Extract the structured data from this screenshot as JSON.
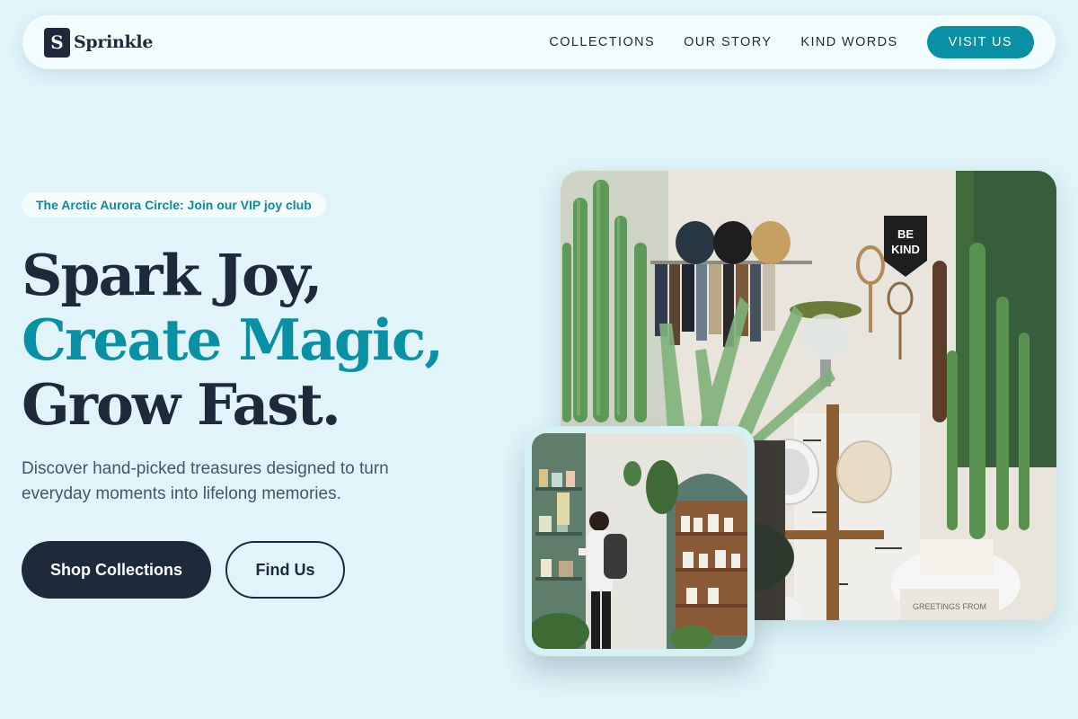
{
  "brand": {
    "logo_letter": "S",
    "name": "Sprinkle"
  },
  "nav": {
    "links": [
      "COLLECTIONS",
      "OUR STORY",
      "KIND WORDS"
    ],
    "cta": "VISIT US"
  },
  "hero": {
    "badge": "The Arctic Aurora Circle: Join our VIP joy club",
    "headline": [
      "Spark Joy,",
      "Create Magic,",
      "Grow Fast."
    ],
    "subtext": "Discover hand-picked treasures designed to turn everyday moments into lifelong memories.",
    "primary_button": "Shop Collections",
    "secondary_button": "Find Us"
  },
  "photo": {
    "banner_text": [
      "BE",
      "KIND"
    ],
    "card_text": "GREETINGS FROM"
  },
  "colors": {
    "background": "#e0f4fa",
    "accent": "#0891a5",
    "dark": "#1e293b",
    "muted_text": "#475569"
  },
  "icons": {
    "logo": "logo-mark"
  }
}
